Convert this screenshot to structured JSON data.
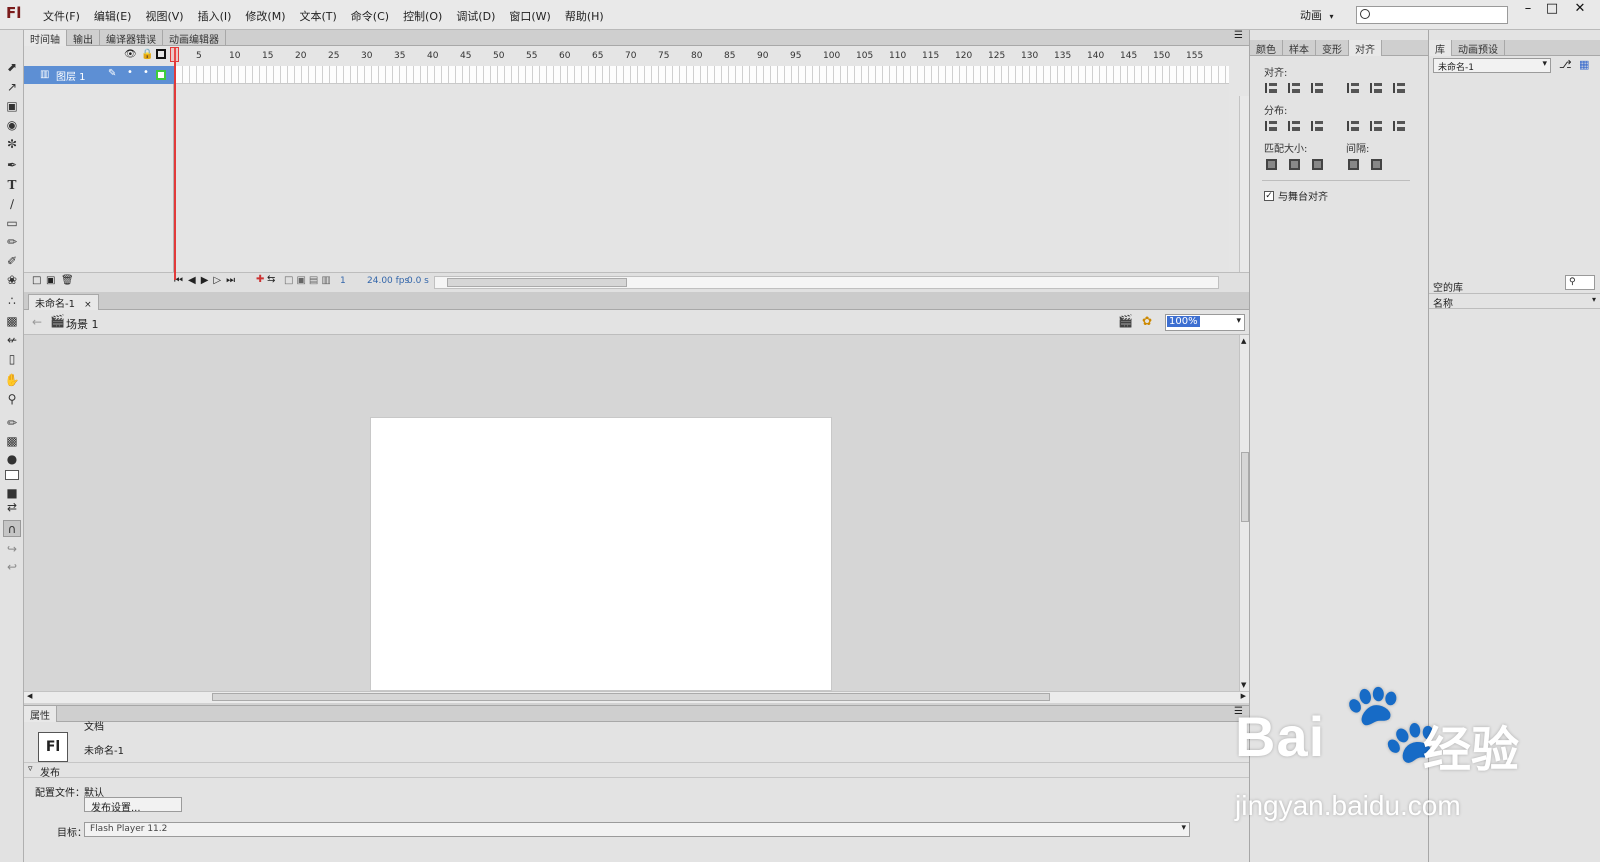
{
  "app": {
    "logo": "Fl"
  },
  "menu": {
    "items": [
      "文件(F)",
      "编辑(E)",
      "视图(V)",
      "插入(I)",
      "修改(M)",
      "文本(T)",
      "命令(C)",
      "控制(O)",
      "调试(D)",
      "窗口(W)",
      "帮助(H)"
    ]
  },
  "workspace": {
    "label": "动画"
  },
  "timeline": {
    "tabs": [
      "时间轴",
      "输出",
      "编译器错误",
      "动画编辑器"
    ],
    "ruler": [
      "5",
      "10",
      "15",
      "20",
      "25",
      "30",
      "35",
      "40",
      "45",
      "50",
      "55",
      "60",
      "65",
      "70",
      "75",
      "80",
      "85",
      "90",
      "95",
      "100",
      "105",
      "110",
      "115",
      "120",
      "125",
      "130",
      "135",
      "140",
      "145",
      "150",
      "155"
    ],
    "layer_name": "图层 1",
    "current_frame": "1",
    "fps": "24.00 fps",
    "time": "0.0 s"
  },
  "document": {
    "tab": "未命名-1",
    "tab_close": "×",
    "scene": "场景 1",
    "zoom": "100%"
  },
  "properties": {
    "tab": "属性",
    "type": "文档",
    "doc_name": "未命名-1",
    "publish_section": "发布",
    "profile_label": "配置文件：",
    "profile_value": "默认",
    "publish_settings": "发布设置...",
    "target_label": "目标：",
    "target_value": "Flash Player 11.2"
  },
  "align": {
    "tabs": [
      "颜色",
      "样本",
      "变形",
      "对齐"
    ],
    "align_label": "对齐:",
    "distribute_label": "分布:",
    "match_size_label": "匹配大小:",
    "spacing_label": "间隔:",
    "to_stage": "与舞台对齐"
  },
  "library": {
    "tabs": [
      "库",
      "动画预设"
    ],
    "doc_select": "未命名-1",
    "empty_label": "空的库",
    "name_column": "名称"
  },
  "watermark": {
    "brand": "Bai",
    "brand_cn": "经验",
    "url": "jingyan.baidu.com"
  },
  "colors": {
    "selection": "#5d8fd4",
    "playhead": "#e23a3a"
  }
}
